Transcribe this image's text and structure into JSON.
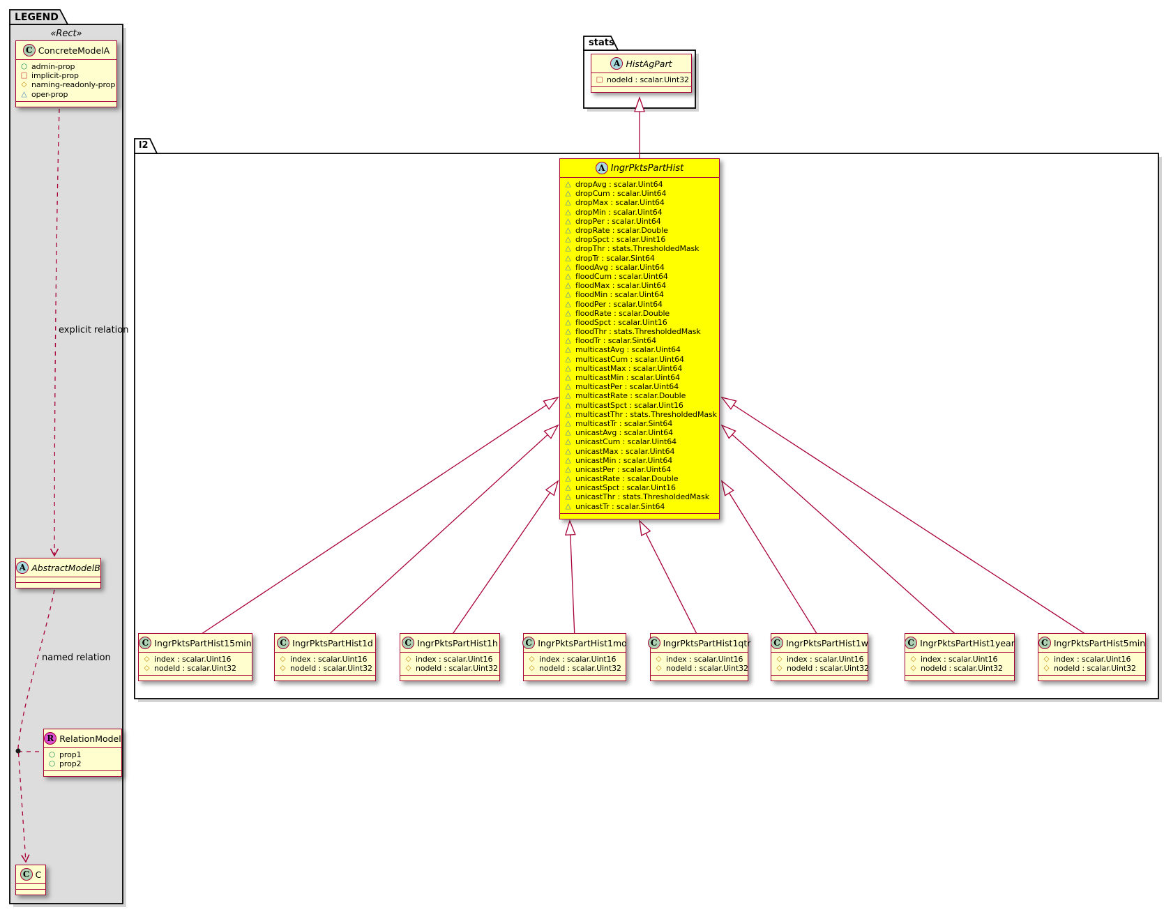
{
  "colors": {
    "line_red": "#A80036",
    "class_bg": "#FEFECE",
    "highlight_bg": "#FFFF00",
    "legend_bg": "#DDDDDD",
    "spot_class_green": "#ADD1B2",
    "spot_abstract_blue": "#A9DCDF",
    "spot_relation_magenta": "#D94FD1",
    "icon_circle_green": "#038048",
    "icon_square_red": "#C82930",
    "icon_diamond_orange": "#C78500",
    "icon_triangle_blue": "#3C7FC0"
  },
  "legend": {
    "tab_label": "LEGEND",
    "stereotype": "«Rect»",
    "concrete_model": {
      "spot": "C",
      "name": "ConcreteModelA",
      "attrs": [
        {
          "icon": "circle",
          "text": "admin-prop"
        },
        {
          "icon": "square",
          "text": "implicit-prop"
        },
        {
          "icon": "diamond",
          "text": "naming-readonly-prop"
        },
        {
          "icon": "triangle",
          "text": "oper-prop"
        }
      ]
    },
    "explicit_relation_label": "explicit relation",
    "abstract_model": {
      "spot": "A",
      "name": "AbstractModelB"
    },
    "named_relation_label": "named relation",
    "relation_model": {
      "spot": "R",
      "name": "RelationModel",
      "attrs": [
        {
          "icon": "circle",
          "text": "prop1"
        },
        {
          "icon": "circle",
          "text": "prop2"
        }
      ]
    },
    "c_class": {
      "spot": "C",
      "name": "C"
    }
  },
  "stats_package": {
    "tab_label": "stats",
    "hist_ag_part": {
      "spot": "A",
      "name": "HistAgPart",
      "attrs": [
        {
          "icon": "square",
          "text": "nodeId : scalar.Uint32"
        }
      ]
    }
  },
  "l2_package": {
    "tab_label": "l2",
    "parent_class": {
      "spot": "A",
      "name": "IngrPktsPartHist",
      "attrs": [
        {
          "icon": "triangle",
          "text": "dropAvg : scalar.Uint64"
        },
        {
          "icon": "triangle",
          "text": "dropCum : scalar.Uint64"
        },
        {
          "icon": "triangle",
          "text": "dropMax : scalar.Uint64"
        },
        {
          "icon": "triangle",
          "text": "dropMin : scalar.Uint64"
        },
        {
          "icon": "triangle",
          "text": "dropPer : scalar.Uint64"
        },
        {
          "icon": "triangle",
          "text": "dropRate : scalar.Double"
        },
        {
          "icon": "triangle",
          "text": "dropSpct : scalar.Uint16"
        },
        {
          "icon": "triangle",
          "text": "dropThr : stats.ThresholdedMask"
        },
        {
          "icon": "triangle",
          "text": "dropTr : scalar.Sint64"
        },
        {
          "icon": "triangle",
          "text": "floodAvg : scalar.Uint64"
        },
        {
          "icon": "triangle",
          "text": "floodCum : scalar.Uint64"
        },
        {
          "icon": "triangle",
          "text": "floodMax : scalar.Uint64"
        },
        {
          "icon": "triangle",
          "text": "floodMin : scalar.Uint64"
        },
        {
          "icon": "triangle",
          "text": "floodPer : scalar.Uint64"
        },
        {
          "icon": "triangle",
          "text": "floodRate : scalar.Double"
        },
        {
          "icon": "triangle",
          "text": "floodSpct : scalar.Uint16"
        },
        {
          "icon": "triangle",
          "text": "floodThr : stats.ThresholdedMask"
        },
        {
          "icon": "triangle",
          "text": "floodTr : scalar.Sint64"
        },
        {
          "icon": "triangle",
          "text": "multicastAvg : scalar.Uint64"
        },
        {
          "icon": "triangle",
          "text": "multicastCum : scalar.Uint64"
        },
        {
          "icon": "triangle",
          "text": "multicastMax : scalar.Uint64"
        },
        {
          "icon": "triangle",
          "text": "multicastMin : scalar.Uint64"
        },
        {
          "icon": "triangle",
          "text": "multicastPer : scalar.Uint64"
        },
        {
          "icon": "triangle",
          "text": "multicastRate : scalar.Double"
        },
        {
          "icon": "triangle",
          "text": "multicastSpct : scalar.Uint16"
        },
        {
          "icon": "triangle",
          "text": "multicastThr : stats.ThresholdedMask"
        },
        {
          "icon": "triangle",
          "text": "multicastTr : scalar.Sint64"
        },
        {
          "icon": "triangle",
          "text": "unicastAvg : scalar.Uint64"
        },
        {
          "icon": "triangle",
          "text": "unicastCum : scalar.Uint64"
        },
        {
          "icon": "triangle",
          "text": "unicastMax : scalar.Uint64"
        },
        {
          "icon": "triangle",
          "text": "unicastMin : scalar.Uint64"
        },
        {
          "icon": "triangle",
          "text": "unicastPer : scalar.Uint64"
        },
        {
          "icon": "triangle",
          "text": "unicastRate : scalar.Double"
        },
        {
          "icon": "triangle",
          "text": "unicastSpct : scalar.Uint16"
        },
        {
          "icon": "triangle",
          "text": "unicastThr : stats.ThresholdedMask"
        },
        {
          "icon": "triangle",
          "text": "unicastTr : scalar.Sint64"
        }
      ]
    },
    "children": [
      {
        "spot": "C",
        "name": "IngrPktsPartHist15min",
        "attrs": [
          {
            "icon": "diamond",
            "text": "index : scalar.Uint16"
          },
          {
            "icon": "diamond",
            "text": "nodeId : scalar.Uint32"
          }
        ]
      },
      {
        "spot": "C",
        "name": "IngrPktsPartHist1d",
        "attrs": [
          {
            "icon": "diamond",
            "text": "index : scalar.Uint16"
          },
          {
            "icon": "diamond",
            "text": "nodeId : scalar.Uint32"
          }
        ]
      },
      {
        "spot": "C",
        "name": "IngrPktsPartHist1h",
        "attrs": [
          {
            "icon": "diamond",
            "text": "index : scalar.Uint16"
          },
          {
            "icon": "diamond",
            "text": "nodeId : scalar.Uint32"
          }
        ]
      },
      {
        "spot": "C",
        "name": "IngrPktsPartHist1mo",
        "attrs": [
          {
            "icon": "diamond",
            "text": "index : scalar.Uint16"
          },
          {
            "icon": "diamond",
            "text": "nodeId : scalar.Uint32"
          }
        ]
      },
      {
        "spot": "C",
        "name": "IngrPktsPartHist1qtr",
        "attrs": [
          {
            "icon": "diamond",
            "text": "index : scalar.Uint16"
          },
          {
            "icon": "diamond",
            "text": "nodeId : scalar.Uint32"
          }
        ]
      },
      {
        "spot": "C",
        "name": "IngrPktsPartHist1w",
        "attrs": [
          {
            "icon": "diamond",
            "text": "index : scalar.Uint16"
          },
          {
            "icon": "diamond",
            "text": "nodeId : scalar.Uint32"
          }
        ]
      },
      {
        "spot": "C",
        "name": "IngrPktsPartHist1year",
        "attrs": [
          {
            "icon": "diamond",
            "text": "index : scalar.Uint16"
          },
          {
            "icon": "diamond",
            "text": "nodeId : scalar.Uint32"
          }
        ]
      },
      {
        "spot": "C",
        "name": "IngrPktsPartHist5min",
        "attrs": [
          {
            "icon": "diamond",
            "text": "index : scalar.Uint16"
          },
          {
            "icon": "diamond",
            "text": "nodeId : scalar.Uint32"
          }
        ]
      }
    ]
  }
}
